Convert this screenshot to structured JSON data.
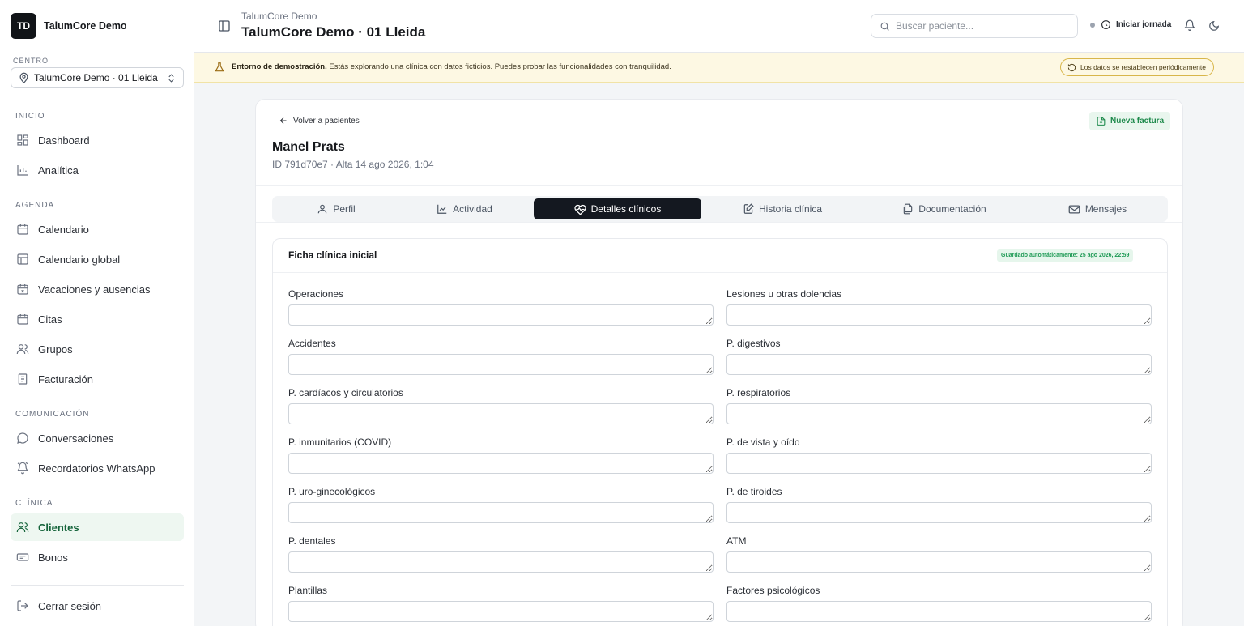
{
  "sidebar": {
    "logo_initials": "TD",
    "brand_name": "TalumCore Demo",
    "centro_label": "CENTRO",
    "centro_value": "TalumCore Demo · 01 Lleida",
    "sections": {
      "inicio": "INICIO",
      "agenda": "AGENDA",
      "comunicacion": "COMUNICACIÓN",
      "clinica": "CLÍNICA"
    },
    "items": {
      "dashboard": "Dashboard",
      "analitica": "Analítica",
      "calendario": "Calendario",
      "calendario_global": "Calendario global",
      "vacaciones": "Vacaciones y ausencias",
      "citas": "Citas",
      "grupos": "Grupos",
      "facturacion": "Facturación",
      "conversaciones": "Conversaciones",
      "recordatorios": "Recordatorios WhatsApp",
      "clientes": "Clientes",
      "bonos": "Bonos"
    },
    "logout": "Cerrar sesión"
  },
  "header": {
    "subtitle": "TalumCore Demo",
    "title": "TalumCore Demo · 01 Lleida",
    "search_placeholder": "Buscar paciente...",
    "jornada_label": "Iniciar jornada"
  },
  "banner": {
    "bold": "Entorno de demostración.",
    "text": " Estás explorando una clínica con datos ficticios. Puedes probar las funcionalidades con tranquilidad.",
    "reset_label": "Los datos se restablecen periódicamente"
  },
  "patient": {
    "back_label": "Volver a pacientes",
    "new_invoice_label": "Nueva factura",
    "name": "Manel Prats",
    "meta": "ID 791d70e7 · Alta 14 ago 2026, 1:04"
  },
  "tabs": {
    "perfil": "Perfil",
    "actividad": "Actividad",
    "detalles": "Detalles clínicos",
    "historia": "Historia clínica",
    "documentacion": "Documentación",
    "mensajes": "Mensajes",
    "active": "Detalles clínicos"
  },
  "form": {
    "title": "Ficha clínica inicial",
    "saved_badge": "Guardado automáticamente: 25 ago 2026, 22:59",
    "fields": {
      "operaciones": {
        "label": "Operaciones",
        "value": ""
      },
      "lesiones": {
        "label": "Lesiones u otras dolencias",
        "value": ""
      },
      "accidentes": {
        "label": "Accidentes",
        "value": ""
      },
      "digestivos": {
        "label": "P. digestivos",
        "value": ""
      },
      "cardiacos": {
        "label": "P. cardíacos y circulatorios",
        "value": ""
      },
      "respiratorios": {
        "label": "P. respiratorios",
        "value": ""
      },
      "inmunitarios": {
        "label": "P. inmunitarios (COVID)",
        "value": ""
      },
      "vista": {
        "label": "P. de vista y oído",
        "value": ""
      },
      "uro": {
        "label": "P. uro-ginecológicos",
        "value": ""
      },
      "tiroides": {
        "label": "P. de tiroides",
        "value": ""
      },
      "dentales": {
        "label": "P. dentales",
        "value": ""
      },
      "atm": {
        "label": "ATM",
        "value": ""
      },
      "plantillas": {
        "label": "Plantillas",
        "value": ""
      },
      "psicologicos": {
        "label": "Factores psicológicos",
        "value": ""
      }
    }
  },
  "colors": {
    "accent_green": "#1e8a4c",
    "active_tab_bg": "#141820",
    "banner_bg": "#fdf8e3"
  }
}
